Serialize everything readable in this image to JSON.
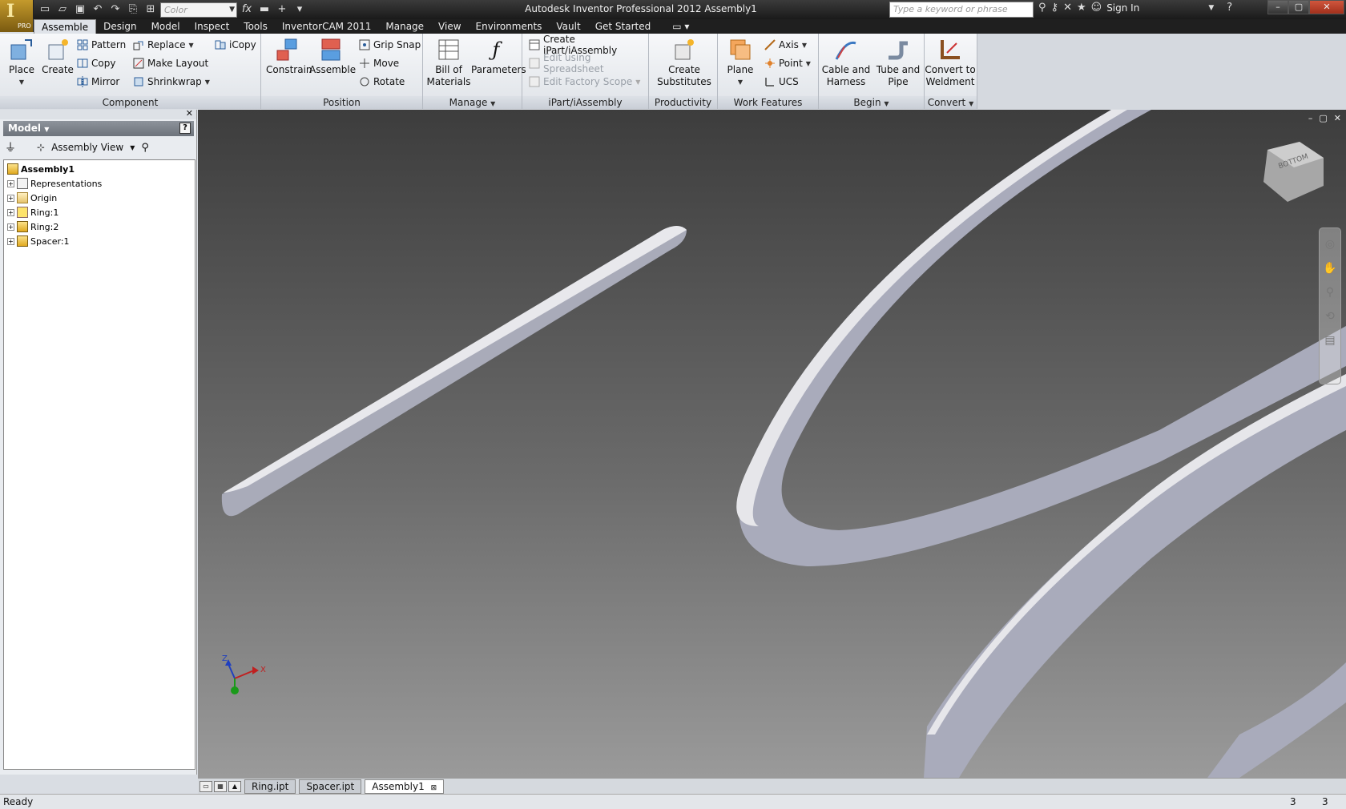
{
  "app": {
    "logo": "I",
    "logo_sub": "PRO",
    "title": "Autodesk Inventor Professional 2012    Assembly1"
  },
  "qat": {
    "color_placeholder": "Color",
    "fx": "fx"
  },
  "search": {
    "placeholder": "Type a keyword or phrase"
  },
  "signin": "Sign In",
  "tabs": [
    "Assemble",
    "Design",
    "Model",
    "Inspect",
    "Tools",
    "InventorCAM 2011",
    "Manage",
    "View",
    "Environments",
    "Vault",
    "Get Started"
  ],
  "ribbon": {
    "component": {
      "title": "Component",
      "place": "Place",
      "create": "Create",
      "pattern": "Pattern",
      "copy": "Copy",
      "mirror": "Mirror",
      "replace": "Replace",
      "make_layout": "Make Layout",
      "shrinkwrap": "Shrinkwrap",
      "icopy": "iCopy"
    },
    "position": {
      "title": "Position",
      "constrain": "Constrain",
      "assemble": "Assemble",
      "grip_snap": "Grip Snap",
      "move": "Move",
      "rotate": "Rotate"
    },
    "manage": {
      "title": "Manage",
      "bom_1": "Bill of",
      "bom_2": "Materials",
      "parameters": "Parameters"
    },
    "ipart": {
      "title": "iPart/iAssembly",
      "create": "Create iPart/iAssembly",
      "edit_spreadsheet": "Edit using Spreadsheet",
      "edit_factory": "Edit Factory Scope"
    },
    "productivity": {
      "title": "Productivity",
      "create_1": "Create",
      "create_2": "Substitutes"
    },
    "work": {
      "title": "Work Features",
      "plane": "Plane",
      "axis": "Axis",
      "point": "Point",
      "ucs": "UCS"
    },
    "begin": {
      "title": "Begin",
      "cable_1": "Cable and",
      "cable_2": "Harness",
      "tube_1": "Tube and",
      "tube_2": "Pipe"
    },
    "convert": {
      "title": "Convert",
      "conv_1": "Convert to",
      "conv_2": "Weldment"
    }
  },
  "browser": {
    "header": "Model",
    "view": "Assembly View",
    "tree": [
      {
        "label": "Assembly1",
        "bold": true
      },
      {
        "label": "Representations"
      },
      {
        "label": "Origin"
      },
      {
        "label": "Ring:1"
      },
      {
        "label": "Ring:2"
      },
      {
        "label": "Spacer:1"
      }
    ]
  },
  "viewcube": {
    "face": "BOTTOM"
  },
  "triad": {
    "z": "Z",
    "x": "X"
  },
  "doc_tabs": [
    "Ring.ipt",
    "Spacer.ipt",
    "Assembly1"
  ],
  "status": {
    "text": "Ready",
    "n1": "3",
    "n2": "3"
  }
}
